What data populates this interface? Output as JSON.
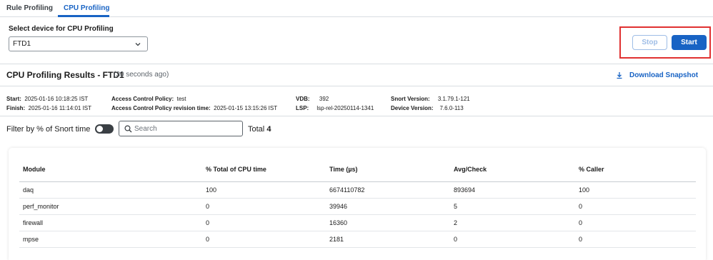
{
  "tabs": [
    {
      "label": "Rule Profiling",
      "active": false
    },
    {
      "label": "CPU Profiling",
      "active": true
    }
  ],
  "device": {
    "label": "Select device for CPU Profiling",
    "selected": "FTD1"
  },
  "buttons": {
    "stop_label": "Stop",
    "start_label": "Start"
  },
  "results": {
    "title": "CPU Profiling Results - FTD1",
    "ago": "(30 seconds ago)",
    "download_label": "Download Snapshot"
  },
  "meta": {
    "start_label": "Start:",
    "start_value": "2025-01-16 10:18:25 IST",
    "finish_label": "Finish:",
    "finish_value": "2025-01-16 11:14:01 IST",
    "acp_label": "Access Control Policy:",
    "acp_value": "test",
    "acp_rev_label": "Access Control Policy revision time:",
    "acp_rev_value": "2025-01-15 13:15:26 IST",
    "vdb_label": "VDB:",
    "vdb_value": "392",
    "lsp_label": "LSP:",
    "lsp_value": "lsp-rel-20250114-1341",
    "snort_label": "Snort Version:",
    "snort_value": "3.1.79.1-121",
    "device_version_label": "Device Version:",
    "device_version_value": "7.6.0-113"
  },
  "filter": {
    "label": "Filter by % of Snort time",
    "toggle_on": false,
    "search_placeholder": "Search",
    "total_label": "Total",
    "total_value": "4"
  },
  "table": {
    "headers": [
      "Module",
      "% Total of CPU time",
      "Time (µs)",
      "Avg/Check",
      "% Caller"
    ],
    "rows": [
      [
        "daq",
        "100",
        "6674110782",
        "893694",
        "100"
      ],
      [
        "perf_monitor",
        "0",
        "39946",
        "5",
        "0"
      ],
      [
        "firewall",
        "0",
        "16360",
        "2",
        "0"
      ],
      [
        "mpse",
        "0",
        "2181",
        "0",
        "0"
      ]
    ]
  },
  "colors": {
    "accent": "#1863c4",
    "highlight_border": "#e03131"
  },
  "icons": {
    "select_chevron": "chevron-down-icon",
    "download": "download-icon",
    "search": "search-icon"
  }
}
